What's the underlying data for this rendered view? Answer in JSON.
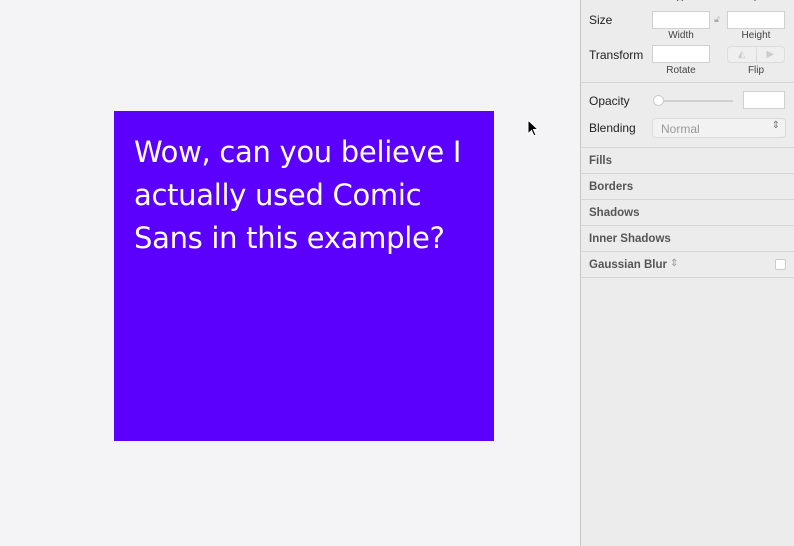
{
  "artboard": {
    "text": "Wow, can you believe I actually used Comic Sans in this example?",
    "fill": "#5b00fd"
  },
  "inspector": {
    "x_label": "X",
    "y_label": "Y",
    "size_label": "Size",
    "width_label": "Width",
    "height_label": "Height",
    "transform_label": "Transform",
    "rotate_label": "Rotate",
    "flip_label": "Flip",
    "opacity_label": "Opacity",
    "blending_label": "Blending",
    "blending_value": "Normal",
    "sections": [
      "Fills",
      "Borders",
      "Shadows",
      "Inner Shadows",
      "Gaussian Blur"
    ],
    "opacity_slider": 0
  }
}
